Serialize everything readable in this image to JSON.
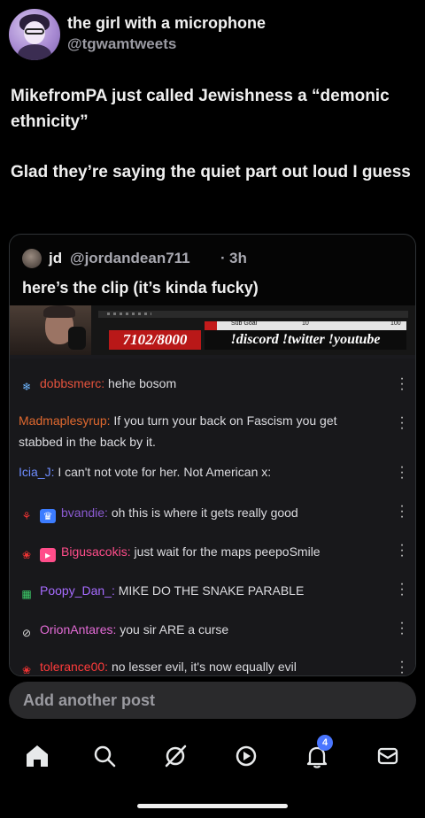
{
  "post": {
    "author_name": "the girl with a microphone",
    "author_handle": "@tgwamtweets",
    "text_line1": "MikefromPA just called Jewishness a “demonic ethnicity”",
    "text_line2": "Glad they’re saying the quiet part out loud I guess"
  },
  "quote": {
    "name": "jd",
    "handle": "@jordandean711",
    "separator": "·",
    "time": "3h",
    "text": "here’s the clip (it’s kinda fucky)"
  },
  "stream": {
    "count": "7102/8000",
    "sub_goal_label": "Sub Goal",
    "sub_goal_mid": "10",
    "sub_goal_max": "100",
    "links": "!discord !twitter !youtube"
  },
  "chat": [
    {
      "user": "dobbsmerc",
      "sep": ":",
      "text": " hehe bosom",
      "color": "#e5533d",
      "badges": [
        "snowflake-icon"
      ]
    },
    {
      "user": "Madmaplesyrup",
      "sep": ":",
      "text": " If you turn your back on Fascism you get stabbed in the back by it.",
      "color": "#e0692f",
      "badges": []
    },
    {
      "user": "Icia_J",
      "sep": ":",
      "text": " I can't not vote for her. Not American x:",
      "color": "#6e8cff",
      "badges": []
    },
    {
      "user": "bvandie",
      "sep": ":",
      "text": " oh this is where it gets really good",
      "color": "#8a5ad0",
      "badges": [
        "flower-icon",
        "crown-icon"
      ]
    },
    {
      "user": "Bigusacokis",
      "sep": ":",
      "text": " just wait for the maps peepoSmile",
      "color": "#ff4d8a",
      "badges": [
        "rose-icon",
        "sub-badge-icon"
      ]
    },
    {
      "user": "Poopy_Dan_",
      "sep": ":",
      "text": " MIKE DO THE SNAKE PARABLE",
      "color": "#a66bff",
      "badges": [
        "gift-icon"
      ]
    },
    {
      "user": "OrionAntares",
      "sep": ":",
      "text": " you sir ARE a curse",
      "color": "#e36bd6",
      "badges": [
        "no-audio-icon"
      ]
    },
    {
      "user": "tolerance00",
      "sep": ":",
      "text": " no lesser evil, it's now equally evil",
      "color": "#ff3b3b",
      "badges": [
        "rose-icon"
      ]
    }
  ],
  "composer": {
    "placeholder": "Add another post"
  },
  "nav": {
    "notif_count": "4"
  },
  "colors": {
    "accent": "#4a76ff",
    "stream_red": "#b91818"
  }
}
